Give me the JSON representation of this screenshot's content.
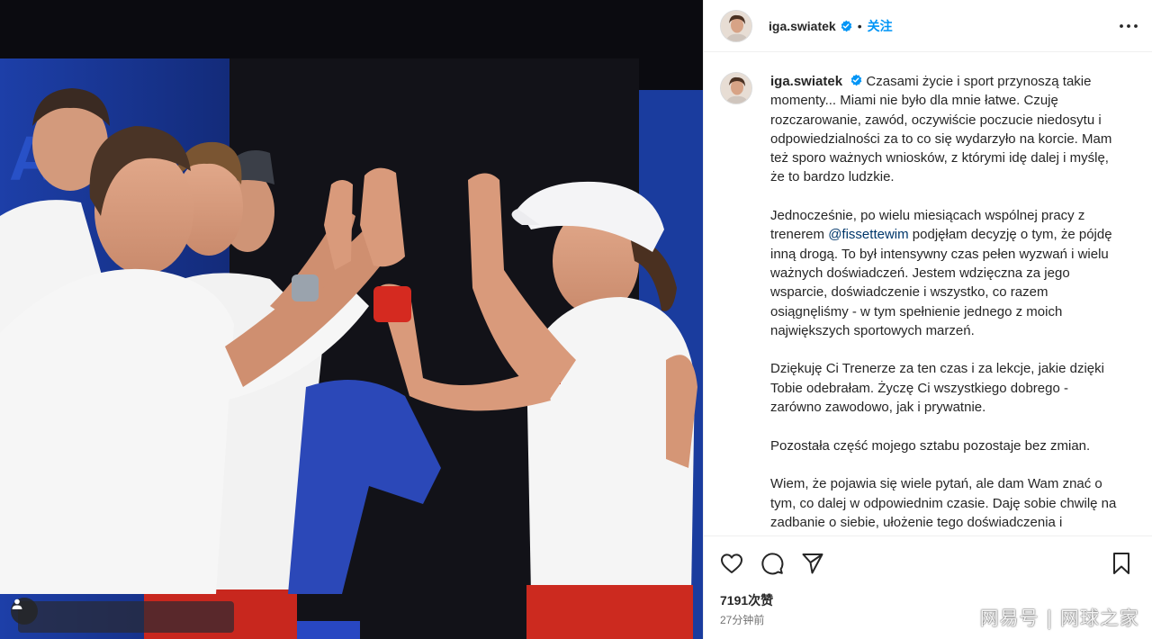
{
  "post": {
    "username": "iga.swiatek",
    "follow_label": "关注",
    "likes": "7191次赞",
    "time_ago": "27分钟前"
  },
  "caption": {
    "username": "iga.swiatek",
    "p1": "Czasami życie i sport przynoszą takie momenty... Miami nie było dla mnie łatwe. Czuję rozczarowanie, zawód, oczywiście poczucie niedosytu i odpowiedzialności za to co się wydarzyło na korcie. Mam też sporo ważnych wniosków, z którymi idę dalej i myślę, że to bardzo ludzkie.",
    "p2_before": "Jednocześnie, po wielu miesiącach wspólnej pracy z trenerem ",
    "p2_mention": "@fissettewim",
    "p2_after": " podjęłam decyzję o tym, że pójdę inną drogą. To był intensywny czas pełen wyzwań i wielu ważnych doświadczeń. Jestem wdzięczna za jego wsparcie, doświadczenie i wszystko, co razem osiągnęliśmy - w tym spełnienie jednego z moich największych sportowych marzeń.",
    "p3": "Dziękuję Ci Trenerze za ten czas i za lekcje, jakie dzięki Tobie odebrałam. Życzę Ci wszystkiego dobrego - zarówno zawodowo, jak i prywatnie.",
    "p4": "Pozostała część mojego sztabu pozostaje bez zmian.",
    "p5": "Wiem, że pojawia się wiele pytań, ale dam Wam znać o tym, co dalej w odpowiednim czasie. Daję sobie chwilę na zadbanie o siebie, ułożenie tego doświadczenia i"
  },
  "watermark": "网易号 | 网球之家",
  "icons": {
    "verified": "verified-badge-icon",
    "more": "more-options-icon",
    "like": "heart-icon",
    "comment": "comment-icon",
    "share": "send-icon",
    "save": "bookmark-icon",
    "tag": "user-tag-icon"
  },
  "colors": {
    "accent": "#0095f6",
    "verified": "#0095f6",
    "mention": "#00376b",
    "muted": "#737373"
  }
}
